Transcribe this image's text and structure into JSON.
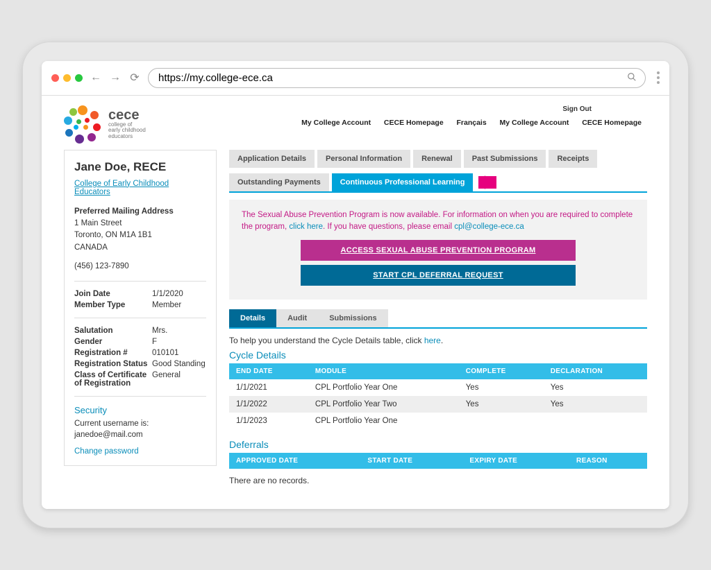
{
  "browser": {
    "url": "https://my.college-ece.ca"
  },
  "logo": {
    "title": "cece",
    "subtitle": "college of\nearly childhood\neducators"
  },
  "topnav": {
    "signout": "Sign Out",
    "items": [
      "My College Account",
      "CECE Homepage",
      "Français",
      "My College Account",
      "CECE Homepage"
    ]
  },
  "member": {
    "name": "Jane Doe, RECE",
    "org": "College of Early Childhood Educators",
    "mailing_label": "Preferred Mailing Address",
    "address_line1": "1 Main Street",
    "address_line2": "Toronto, ON  M1A 1B1",
    "address_line3": "CANADA",
    "phone": "(456) 123-7890",
    "rows1": [
      {
        "k": "Join Date",
        "v": "1/1/2020"
      },
      {
        "k": "Member Type",
        "v": "Member"
      }
    ],
    "rows2": [
      {
        "k": "Salutation",
        "v": "Mrs."
      },
      {
        "k": "Gender",
        "v": "F"
      },
      {
        "k": "Registration #",
        "v": "010101"
      },
      {
        "k": "Registration Status",
        "v": "Good Standing"
      },
      {
        "k": "Class of Certificate of Registration",
        "v": "General"
      }
    ],
    "security_title": "Security",
    "username_label": "Current username is:",
    "username": "janedoe@mail.com",
    "change_pw": "Change password"
  },
  "tabs": {
    "items": [
      "Application Details",
      "Personal Information",
      "Renewal",
      "Past Submissions",
      "Receipts",
      "Outstanding Payments",
      "Continuous Professional Learning"
    ],
    "active_index": 6
  },
  "notice": {
    "text_a": "The Sexual Abuse Prevention Program is now available. For information on when you are required to complete the program, ",
    "link1": "click here",
    "text_b": ". If you have questions, please email ",
    "link2": "cpl@college-ece.ca",
    "btn_pink": "ACCESS SEXUAL ABUSE PREVENTION PROGRAM",
    "btn_blue": "START CPL DEFERRAL REQUEST"
  },
  "subtabs": {
    "items": [
      "Details",
      "Audit",
      "Submissions"
    ],
    "active_index": 0
  },
  "helper": {
    "text": "To help you understand the Cycle Details table, click ",
    "link": "here",
    "after": "."
  },
  "cycle": {
    "title": "Cycle Details",
    "headers": [
      "END DATE",
      "MODULE",
      "COMPLETE",
      "DECLARATION"
    ],
    "rows": [
      {
        "end": "1/1/2021",
        "module": "CPL Portfolio Year One",
        "complete": "Yes",
        "decl": "Yes"
      },
      {
        "end": "1/1/2022",
        "module": "CPL Portfolio Year Two",
        "complete": "Yes",
        "decl": "Yes"
      },
      {
        "end": "1/1/2023",
        "module": "CPL Portfolio Year One",
        "complete": "",
        "decl": ""
      }
    ]
  },
  "deferrals": {
    "title": "Deferrals",
    "headers": [
      "APPROVED DATE",
      "START DATE",
      "EXPIRY DATE",
      "REASON"
    ],
    "empty": "There are no records."
  }
}
